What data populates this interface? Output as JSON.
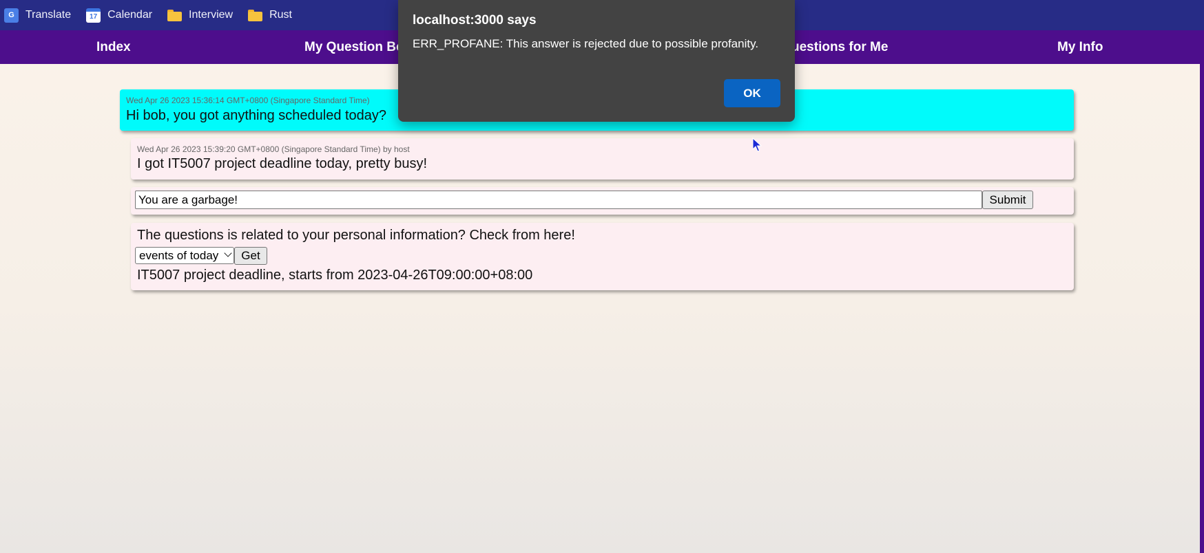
{
  "bookmarks": [
    {
      "label": "Translate",
      "icon": "google-translate-icon"
    },
    {
      "label": "Calendar",
      "icon": "calendar-icon"
    },
    {
      "label": "Interview",
      "icon": "folder-icon"
    },
    {
      "label": "Rust",
      "icon": "folder-icon"
    }
  ],
  "calendar_icon_text": "17",
  "translate_icon_text": "G",
  "nav": {
    "items": [
      "Index",
      "My Question Bo",
      "uestions for Me",
      "My Info"
    ]
  },
  "messages": [
    {
      "time": "Wed Apr 26 2023 15:36:14 GMT+0800 (Singapore Standard Time)",
      "text": "Hi bob, you got anything scheduled today?"
    },
    {
      "time": "Wed Apr 26 2023 15:39:20 GMT+0800 (Singapore Standard Time) by host",
      "text": "I got IT5007 project deadline today, pretty busy!"
    }
  ],
  "answer": {
    "value": "You are a garbage!",
    "submit_label": "Submit"
  },
  "personal_info": {
    "prompt": "The questions is related to your personal information? Check from here!",
    "select_value": "events of today",
    "get_label": "Get",
    "result": "IT5007 project deadline, starts from 2023-04-26T09:00:00+08:00"
  },
  "dialog": {
    "title": "localhost:3000 says",
    "message": "ERR_PROFANE: This answer is rejected due to possible profanity.",
    "ok_label": "OK"
  },
  "colors": {
    "bookmarks_bg": "#272c86",
    "nav_bg": "#4d0e8c",
    "host_message_bg": "#00fbfb",
    "card_bg": "#fdeef2",
    "dialog_bg": "#434343",
    "ok_button": "#0a64c2"
  }
}
